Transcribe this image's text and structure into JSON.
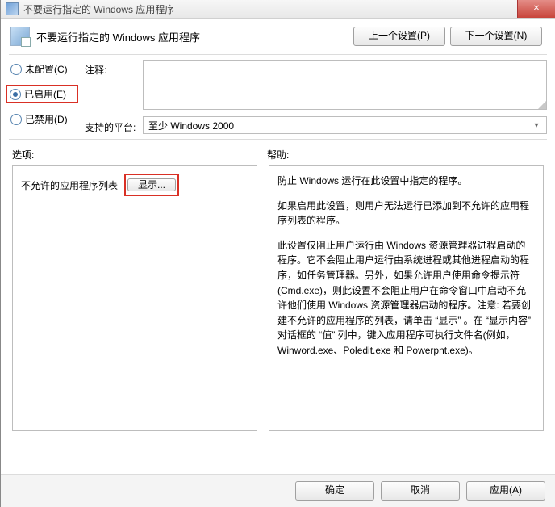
{
  "title_bar": {
    "text": "不要运行指定的 Windows 应用程序"
  },
  "header": {
    "title": "不要运行指定的 Windows 应用程序",
    "prev_button": "上一个设置(P)",
    "next_button": "下一个设置(N)"
  },
  "radios": {
    "not_configured": "未配置(C)",
    "enabled": "已启用(E)",
    "disabled": "已禁用(D)"
  },
  "fields": {
    "comment_label": "注释:",
    "comment_value": "",
    "platform_label": "支持的平台:",
    "platform_value": "至少 Windows 2000"
  },
  "sections": {
    "options": "选项:",
    "help": "帮助:"
  },
  "options_panel": {
    "list_label": "不允许的应用程序列表",
    "show_button": "显示..."
  },
  "help_panel": {
    "p1": "防止 Windows 运行在此设置中指定的程序。",
    "p2": "如果启用此设置，则用户无法运行已添加到不允许的应用程序列表的程序。",
    "p3": "此设置仅阻止用户运行由 Windows 资源管理器进程启动的程序。它不会阻止用户运行由系统进程或其他进程启动的程序，如任务管理器。另外，如果允许用户使用命令提示符(Cmd.exe)，则此设置不会阻止用户在命令窗口中启动不允许他们使用 Windows 资源管理器启动的程序。注意: 若要创建不允许的应用程序的列表，请单击 “显示” 。在 “显示内容” 对话框的 “值” 列中，键入应用程序可执行文件名(例如，Winword.exe、Poledit.exe 和 Powerpnt.exe)。"
  },
  "footer": {
    "ok": "确定",
    "cancel": "取消",
    "apply": "应用(A)"
  }
}
